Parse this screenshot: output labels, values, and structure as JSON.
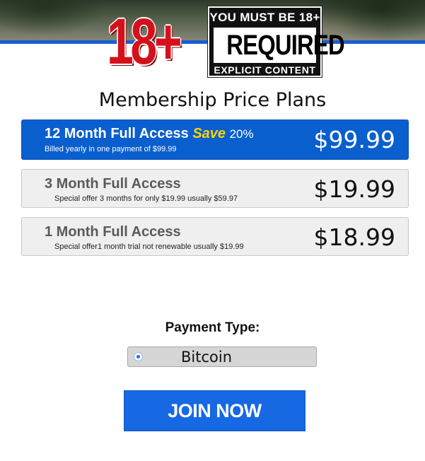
{
  "header": {
    "logo_text": "18+",
    "badge_top": "YOU MUST BE 18+",
    "badge_main": "REQUIRED",
    "badge_bottom": "EXPLICIT CONTENT"
  },
  "heading": "Membership Price Plans",
  "plans": [
    {
      "title": "12 Month Full Access",
      "save_label": "Save",
      "save_pct": "20%",
      "subtitle": "Billed yearly in one payment of  $99.99",
      "price": "$99.99",
      "selected": true
    },
    {
      "title": "3 Month Full Access",
      "subtitle": "Special offer 3 months for only $19.99 usually $59.97",
      "price": "$19.99",
      "selected": false
    },
    {
      "title": "1 Month Full Access",
      "subtitle": "Special offer1 month trial not renewable usually $19.99",
      "price": "$18.99",
      "selected": false
    }
  ],
  "payment": {
    "label": "Payment Type:",
    "selected": "Bitcoin"
  },
  "join_button": "JOIN NOW",
  "colors": {
    "accent_blue": "#0a5fcf",
    "button_blue": "#1668e3",
    "logo_red": "#d4111b",
    "save_yellow": "#ffd400"
  }
}
